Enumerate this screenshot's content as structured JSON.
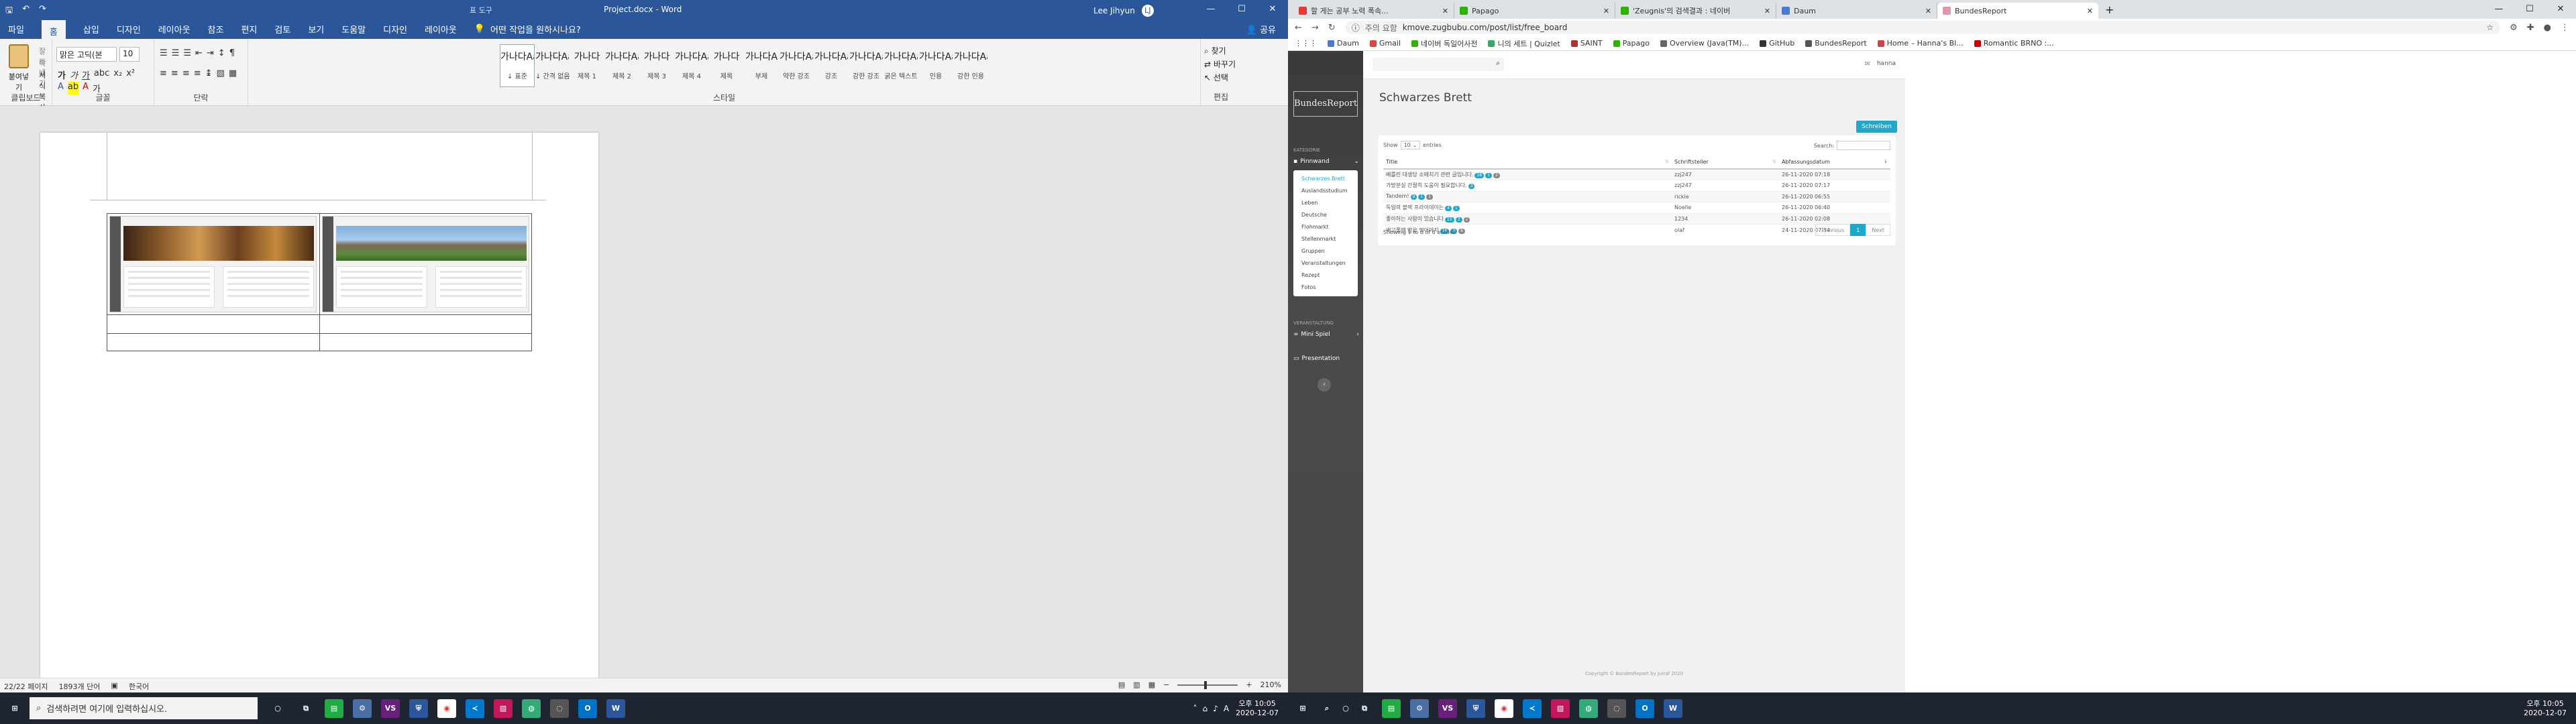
{
  "word": {
    "context_title": "표 도구",
    "doc_title": "Project.docx - Word",
    "user": "Lee Jihyun",
    "avatar": "LJ",
    "tabs": [
      "파일",
      "홈",
      "삽입",
      "디자인",
      "레이아웃",
      "참조",
      "편지",
      "검토",
      "보기",
      "도움말",
      "디자인",
      "레이아웃"
    ],
    "active_tab_index": 1,
    "tell_me": "어떤 작업을 원하시나요?",
    "share": "공유",
    "paste": "붙여넣기",
    "clip_cut": "잘라내기",
    "clip_copy": "복사",
    "clip_format": "서식 복사",
    "font_name": "맑은 고딕(본",
    "font_size": "10",
    "groups": {
      "clipboard": "클립보드",
      "font": "글꼴",
      "paragraph": "단락",
      "styles": "스타일",
      "editing": "편집"
    },
    "styles": [
      {
        "sample": "가나다AaI",
        "name": "↓ 표준"
      },
      {
        "sample": "가나다AaI",
        "name": "↓ 간격 없음"
      },
      {
        "sample": "가나다",
        "name": "제목 1"
      },
      {
        "sample": "가나다AaI",
        "name": "제목 2"
      },
      {
        "sample": "가나다",
        "name": "제목 3"
      },
      {
        "sample": "가나다AaI",
        "name": "제목 4"
      },
      {
        "sample": "가나다",
        "name": "제목"
      },
      {
        "sample": "가나다A",
        "name": "부제"
      },
      {
        "sample": "가나다AaI",
        "name": "약한 강조"
      },
      {
        "sample": "가나다AaI",
        "name": "강조"
      },
      {
        "sample": "가나다AaI",
        "name": "강한 강조"
      },
      {
        "sample": "가나다AaI",
        "name": "굵은 텍스트"
      },
      {
        "sample": "가나다AaI",
        "name": "인용"
      },
      {
        "sample": "가나다AaI",
        "name": "강한 인용"
      }
    ],
    "editing": [
      "찾기",
      "바꾸기",
      "선택"
    ],
    "status": {
      "page": "22/22 페이지",
      "words": "1893개 단어",
      "lang": "한국어",
      "zoom": "210%"
    }
  },
  "taskbar": {
    "search_placeholder": "검색하려면 여기에 입력하십시오.",
    "time": "오후 10:05",
    "date": "2020-12-07",
    "icons": [
      "vs",
      "vscode",
      "chrome",
      "word",
      "outlook"
    ],
    "tray_lang": "A"
  },
  "browser": {
    "tabs": [
      {
        "title": "할 게는 공부 노력 폭속...",
        "color": "#e53935"
      },
      {
        "title": "Papago",
        "color": "#2db400"
      },
      {
        "title": "'Zeugnis'의 검색결과 : 네이버",
        "color": "#2db400"
      },
      {
        "title": "Daum",
        "color": "#4a7bd0"
      },
      {
        "title": "BundesReport",
        "color": "#d9a"
      }
    ],
    "url_prefix": "주의 요함",
    "url": "kmove.zugbubu.com/post/list/free_board",
    "bookmarks": [
      "Daum",
      "Gmail",
      "네이버 독일어사전",
      "니의 세트 | Quizlet",
      "SAINT",
      "Papago",
      "Overview (Java(TM)...",
      "GitHub",
      "BundesReport",
      "Home – Hanna's Bl...",
      "Romantic BRNO :..."
    ],
    "site": {
      "logo": "BundesReport",
      "section_kategorie": "KATEGORIE",
      "pinnwand": "Pinnwand",
      "submenu": [
        "Schwarzes Brett",
        "Auslandsstudium",
        "Leben",
        "Deutsche",
        "Flohmarkt",
        "Stellenmarkt",
        "Gruppen",
        "Veranstaltungen",
        "Rezept",
        "Fotos"
      ],
      "section_veranstaltung": "VERANSTALTUNG",
      "mini_spiel": "Mini Spiel",
      "presentation": "Presentation",
      "user": "hanna",
      "page_title": "Schwarzes Brett",
      "write_button": "Schreiben",
      "show_label": "Show",
      "show_value": "10",
      "entries_label": "entries",
      "search_label": "Search:",
      "columns": [
        "Title",
        "Schriftsteller",
        "Abfassungsdatum"
      ],
      "rows": [
        {
          "title": "베를린 대생당 소매치기 관련 글입니다.",
          "badges": [
            "18",
            "1",
            "2"
          ],
          "author": "zzj247",
          "date": "26-11-2020 07:18"
        },
        {
          "title": "가방분실 간절히 도움이 필요합니다.",
          "badges": [
            "3"
          ],
          "author": "zzj247",
          "date": "26-11-2020 07:17"
        },
        {
          "title": "Tandem!",
          "badges": [
            "9",
            "1",
            "1"
          ],
          "author": "rickie",
          "date": "26-11-2020 06:55"
        },
        {
          "title": "독일의 블랙 프라이데이는",
          "badges": [
            "4",
            "1"
          ],
          "author": "Noelle",
          "date": "26-11-2020 06:40"
        },
        {
          "title": "좋아하는 사람이 있습니다",
          "badges": [
            "15",
            "3",
            "2"
          ],
          "author": "1234",
          "date": "26-11-2020 02:08"
        },
        {
          "title": "배고플땐 밥을 먹어야지",
          "badges": [
            "26",
            "3",
            "6"
          ],
          "author": "olaf",
          "date": "24-11-2020 07:34"
        }
      ],
      "info": "Showing 1 to 6 of 6 entries",
      "prev": "Previous",
      "page": "1",
      "next": "Next",
      "footer": "Copyright © BundesReport by Julraf 2020"
    }
  }
}
